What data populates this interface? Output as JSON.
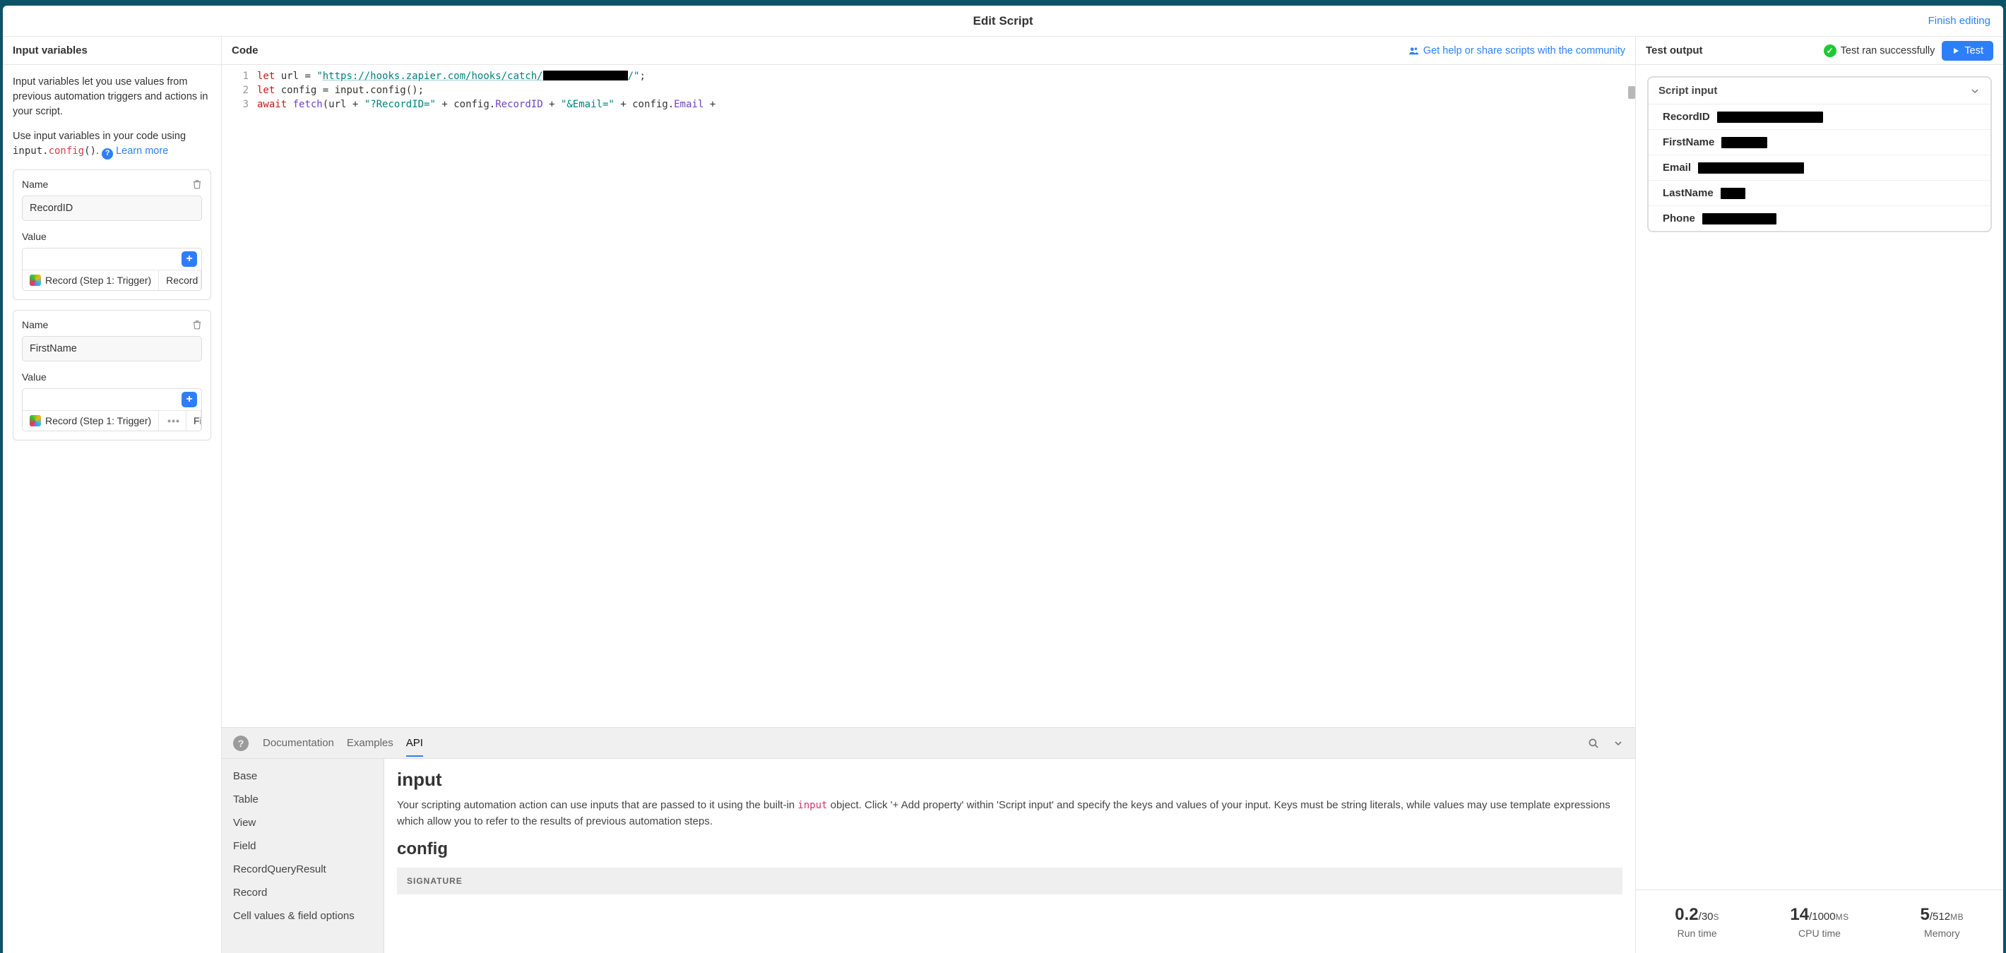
{
  "header": {
    "title": "Edit Script",
    "finish_link": "Finish editing"
  },
  "left": {
    "title": "Input variables",
    "help1": "Input variables let you use values from previous automation triggers and actions in your script.",
    "help2_prefix": "Use input variables in your code using ",
    "help2_code_pre": "input.",
    "help2_code_kw": "config",
    "help2_code_post": "()",
    "help2_suffix": ". ",
    "learn_more": "Learn more",
    "name_label": "Name",
    "value_label": "Value",
    "vars": [
      {
        "name": "RecordID",
        "token_source": "Record (Step 1: Trigger)",
        "token_field": "Record",
        "show_dots": false
      },
      {
        "name": "FirstName",
        "token_source": "Record (Step 1: Trigger)",
        "token_field": "Fir",
        "show_dots": true
      }
    ]
  },
  "code": {
    "title": "Code",
    "community_link": "Get help or share scripts with the community",
    "line_numbers": [
      "1",
      "2",
      "3"
    ],
    "url_visible": "https://hooks.zapier.com/hooks/catch/",
    "docs": {
      "tabs": [
        "Documentation",
        "Examples",
        "API"
      ],
      "active_tab": "API",
      "side_items": [
        "Base",
        "Table",
        "View",
        "Field",
        "RecordQueryResult",
        "Record",
        "Cell values & field options"
      ],
      "h1": "input",
      "para_pre": "Your scripting automation action can use inputs that are passed to it using the built-in ",
      "para_code": "input",
      "para_post": " object. Click '+ Add property' within 'Script input' and specify the keys and values of your input. Keys must be string literals, while values may use template expressions which allow you to refer to the results of previous automation steps.",
      "h2": "config",
      "sig": "SIGNATURE"
    }
  },
  "right": {
    "title": "Test output",
    "status_text": "Test ran successfully",
    "test_button": "Test",
    "script_input_label": "Script input",
    "inputs": [
      {
        "key": "RecordID",
        "redact_w": 150
      },
      {
        "key": "FirstName",
        "redact_w": 65
      },
      {
        "key": "Email",
        "redact_w": 150
      },
      {
        "key": "LastName",
        "redact_w": 35
      },
      {
        "key": "Phone",
        "redact_w": 105
      }
    ],
    "metrics": {
      "run": {
        "value": "0.2",
        "limit": "/30",
        "unit": "S",
        "label": "Run time"
      },
      "cpu": {
        "value": "14",
        "limit": "/1000",
        "unit": "MS",
        "label": "CPU time"
      },
      "mem": {
        "value": "5",
        "limit": "/512",
        "unit": "MB",
        "label": "Memory"
      }
    }
  }
}
